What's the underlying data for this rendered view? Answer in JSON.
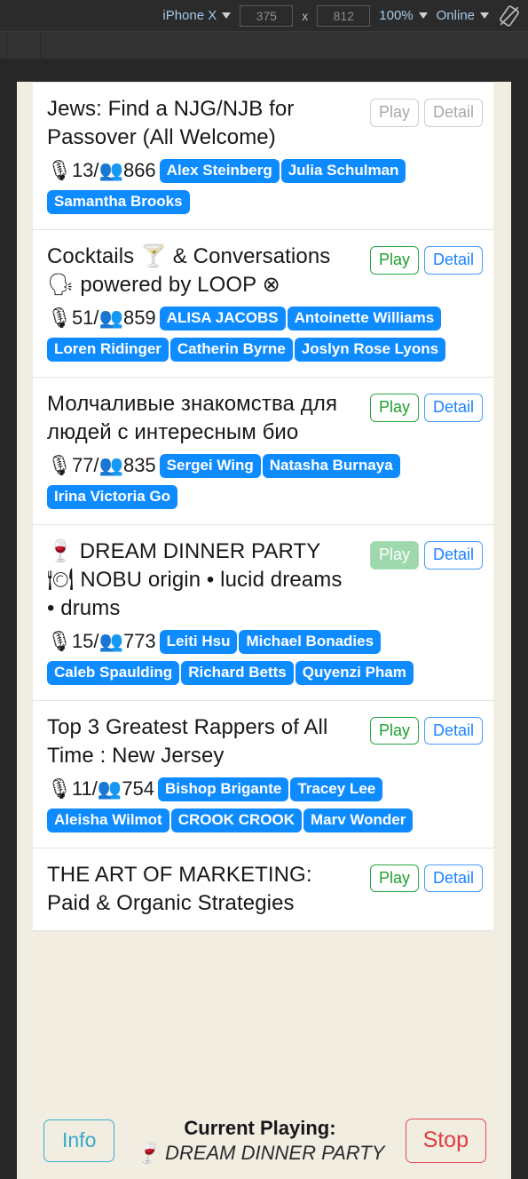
{
  "devtools": {
    "device": "iPhone X",
    "width": "375",
    "height": "812",
    "multiply": "x",
    "zoom": "100%",
    "throttling": "Online",
    "rotate_icon": "rotate-device-icon"
  },
  "rooms": [
    {
      "title": "Jews: Find a NJG/NJB for Passover (All Welcome)",
      "speakers": "13",
      "listeners": "866",
      "separator": "/",
      "play_label": "Play",
      "detail_label": "Detail",
      "state": "disabled",
      "chips": [
        "Alex Steinberg",
        "Julia Schulman",
        "Samantha Brooks"
      ]
    },
    {
      "title": "Cocktails 🍸 & Conversations 🗣 powered by LOOP ⊗",
      "speakers": "51",
      "listeners": "859",
      "separator": "/",
      "play_label": "Play",
      "detail_label": "Detail",
      "state": "idle",
      "chips": [
        "ALISA JACOBS",
        "Antoinette Williams",
        "Loren Ridinger",
        "Catherin Byrne",
        "Joslyn Rose Lyons"
      ]
    },
    {
      "title": "Молчаливые знакомства для людей с интересным био",
      "speakers": "77",
      "listeners": "835",
      "separator": "/",
      "play_label": "Play",
      "detail_label": "Detail",
      "state": "idle",
      "chips": [
        "Sergei Wing",
        "Natasha Burnaya",
        "Irina Victoria Go"
      ]
    },
    {
      "title": "🍷 DREAM DINNER PARTY 🍽 NOBU origin • lucid dreams • drums",
      "speakers": "15",
      "listeners": "773",
      "separator": "/",
      "play_label": "Play",
      "detail_label": "Detail",
      "state": "playing",
      "chips": [
        "Leiti Hsu",
        "Michael Bonadies",
        "Caleb Spaulding",
        "Richard Betts",
        "Quyenzi Pham"
      ]
    },
    {
      "title": "Top 3 Greatest Rappers of All Time : New Jersey",
      "speakers": "11",
      "listeners": "754",
      "separator": "/",
      "play_label": "Play",
      "detail_label": "Detail",
      "state": "idle",
      "chips": [
        "Bishop Brigante",
        "Tracey Lee",
        "Aleisha Wilmot",
        "CROOK CROOK",
        "Marv Wonder"
      ]
    },
    {
      "title": "THE ART OF MARKETING: Paid & Organic Strategies",
      "speakers": "",
      "listeners": "",
      "separator": "/",
      "play_label": "Play",
      "detail_label": "Detail",
      "state": "idle",
      "chips": []
    }
  ],
  "bottom_bar": {
    "info_label": "Info",
    "now_playing_label": "Current Playing:",
    "now_playing_title": "🍷 DREAM DINNER PARTY",
    "stop_label": "Stop"
  },
  "icons": {
    "mic": "🎙",
    "people": "👥"
  },
  "colors": {
    "chip_blue": "#0d8bff",
    "play_green": "#1fa02f",
    "play_active_bg": "#9ed8ac",
    "detail_blue": "#1a82ff",
    "stop_red": "#e03b42",
    "info_teal": "#37a8cb",
    "panel_cream": "#f1ede1",
    "card_white": "#ffffff",
    "chrome_dark": "#2b2b2b"
  }
}
